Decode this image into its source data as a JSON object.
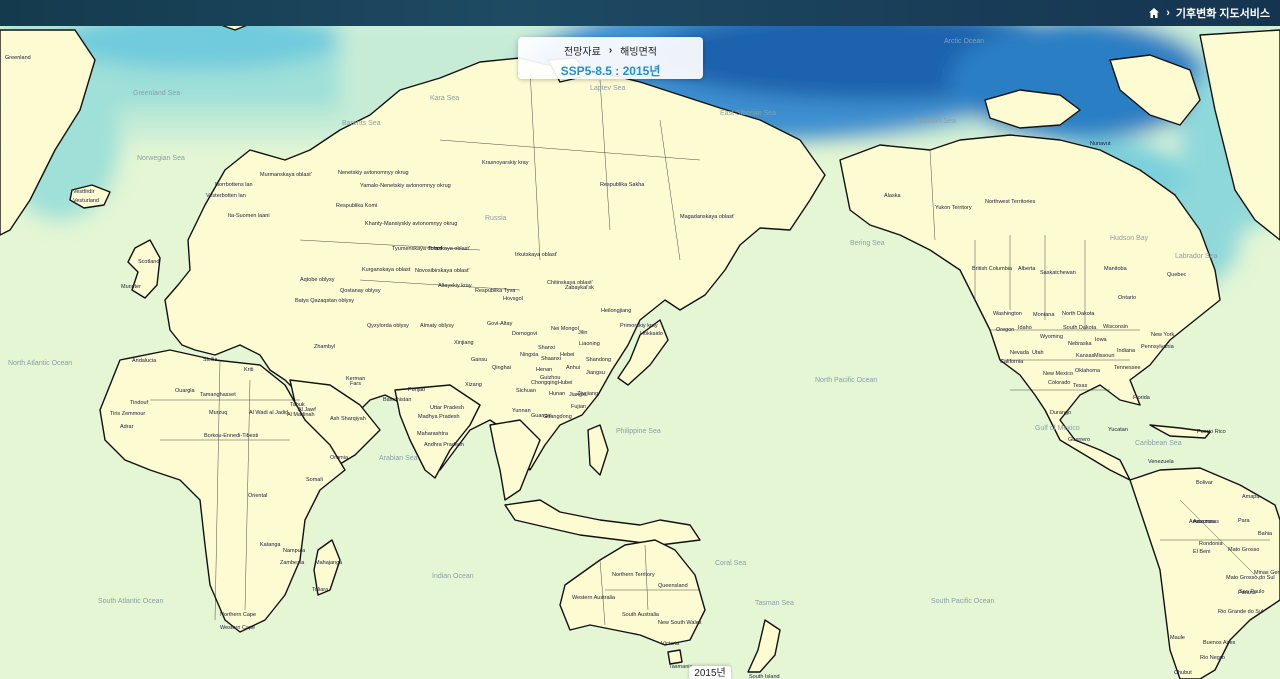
{
  "header": {
    "service_title": "기후변화 지도서비스"
  },
  "info_panel": {
    "category": "전망자료",
    "subcategory": "해빙면적",
    "scenario_title": "SSP5-8.5 : 2015년"
  },
  "timeline": {
    "current_year": "2015년"
  },
  "colors": {
    "land_base": "#fdfbd2",
    "ocean_base": "#e4f6d4",
    "ice_low": "#c6ecd6",
    "ice_mid": "#79d0dc",
    "ice_high": "#2a7fc4",
    "ice_max": "#1a58a6",
    "boundary": "#111111",
    "accent": "#1f8fd6"
  },
  "map": {
    "region_labels": [
      "Greenland",
      "Krasnoyarskiy kray",
      "Respublika Sakha",
      "Magadanskaya oblast'",
      "Alaska",
      "Yukon Territory",
      "Northwest Territories",
      "Nunavut",
      "British Columbia",
      "Alberta",
      "Saskatchewan",
      "Manitoba",
      "Ontario",
      "Quebec",
      "Washington",
      "Montana",
      "North Dakota",
      "Oregon",
      "Idaho",
      "Wyoming",
      "South Dakota",
      "Nebraska",
      "Iowa",
      "Nevada",
      "Utah",
      "Colorado",
      "Kansas",
      "Missouri",
      "California",
      "New Mexico",
      "Oklahoma",
      "Texas",
      "Wisconsin",
      "New York",
      "Pennsylvania",
      "Indiana",
      "Tennessee",
      "Florida",
      "Yucatan",
      "Durango",
      "Guerrero",
      "Puerto Rico",
      "Venezuela",
      "Bolivar",
      "Amazonas",
      "Para",
      "Amapa",
      "Bahia",
      "Rondonia",
      "El Beni",
      "Mato Grosso",
      "Mato Grosso do Sul",
      "Minas Gerais",
      "Sao Paulo",
      "Parana",
      "Rio Grande do Sul",
      "Buenos Aires",
      "Chubut",
      "Rio Negro",
      "Maule",
      "Northern Territory",
      "Queensland",
      "Western Australia",
      "South Australia",
      "New South Wales",
      "Victoria",
      "Tasmania",
      "South Island",
      "Xinjiang",
      "Qinghai",
      "Xizang",
      "Sichuan",
      "Yunnan",
      "Nei Mongol",
      "Jilin",
      "Primorskiy kray",
      "Hokkaido",
      "Heilongjiang",
      "Uttar Pradesh",
      "Madhya Pradesh",
      "Maharashtra",
      "Andhra Pradesh",
      "Punjab",
      "Balochistan",
      "Kerman",
      "Fars",
      "Ash Sharqiyah",
      "Al Madinah",
      "Al Jawf",
      "Tabuk",
      "Murzuq",
      "Al Wadi al Jadid",
      "Borkou-Ennedi-Tibesti",
      "Tiris Zemmour",
      "Adrar",
      "Tindouf",
      "Ouargla",
      "Tamanghasset",
      "Oriental",
      "Katanga",
      "Northern Cape",
      "Western Cape",
      "Nampula",
      "Zambezia",
      "Toliara",
      "Mahajanga",
      "Somali",
      "Oromia",
      "Amazonas",
      "Tomskaya oblast'",
      "Tyumenskaya oblast",
      "Respublika Komi",
      "Murmanskaya oblast'",
      "Norrbottens lan",
      "Vesterbotten lan",
      "Ita-Suomen laani",
      "Vestfirdir",
      "Vesturland",
      "Scotland",
      "Munster",
      "Andalucia",
      "Sicilia",
      "Kriti",
      "Nenetskiy avtonomnyy okrug",
      "Yamalo-Nenetskiy avtonomnyy okrug",
      "Khanty-Mansiyskiy avtonomnyy okrug",
      "Novosibirskaya oblast'",
      "Kurganskaya oblast",
      "Altayskiy kray",
      "Irkutskaya oblast'",
      "Chitinskaya oblast'",
      "Zabaykal'sk",
      "Almaty oblysy",
      "Aqtobe oblysy",
      "Qostanay oblysy",
      "Qyzylorda oblysy",
      "Zhambyl",
      "Batys Qazaqstan oblysy",
      "Respublika Tyva",
      "Hovsgol",
      "Govi-Altay",
      "Dornogovi",
      "Shanxi",
      "Hebei",
      "Henan",
      "Hubei",
      "Hunan",
      "Jiangxi",
      "Zhejiang",
      "Guangdong",
      "Guangxi",
      "Fujian",
      "Gansu",
      "Ningxia",
      "Shaanxi",
      "Liaoning",
      "Anhui",
      "Jiangsu",
      "Shandong",
      "Guizhou",
      "Chongqing"
    ],
    "ocean_labels": [
      "Arctic Ocean",
      "North Atlantic Ocean",
      "South Atlantic Ocean",
      "Indian Ocean",
      "North Pacific Ocean",
      "South Pacific Ocean",
      "Philippine Sea",
      "Arabian Sea",
      "Bering Sea",
      "Labrador Sea",
      "Greenland Sea",
      "Barents Sea",
      "Kara Sea",
      "Laptev Sea",
      "East Siberian Sea",
      "Beaufort Sea",
      "Hudson Bay",
      "Norwegian Sea",
      "Caribbean Sea",
      "Gulf of Mexico",
      "Coral Sea",
      "Tasman Sea",
      "Russia"
    ]
  }
}
